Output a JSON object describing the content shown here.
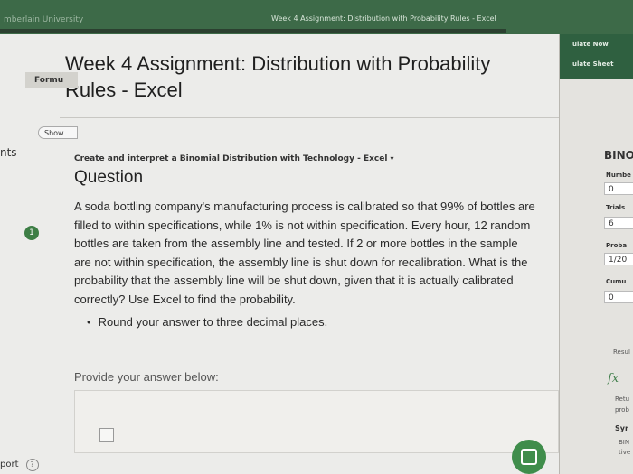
{
  "window": {
    "university_label": "mberlain University",
    "title": "Week 4 Assignment: Distribution with Probability Rules - Excel"
  },
  "page": {
    "title_line1": "Week 4 Assignment: Distribution with Probability",
    "title_line2": "Rules - Excel",
    "side_tab": "nts",
    "question_number": "1",
    "subtitle": "Create and interpret a Binomial Distribution with Technology - Excel",
    "question_heading": "Question",
    "question_lines": [
      "A soda bottling company's manufacturing process is calibrated so that 99% of bottles are",
      "filled to within specifications, while 1% is not within specification. Every hour, 12 random",
      "bottles are taken from the assembly line and tested. If 2 or more bottles in the sample",
      "are not within specification, the assembly line is shut down for recalibration. What is the",
      "probability that the assembly line will be shut down, given that it is actually calibrated",
      "correctly? Use Excel to find the probability."
    ],
    "bullet": "Round your answer to three decimal places.",
    "provide_label": "Provide your answer below:",
    "report_label": "port"
  },
  "sidebar": {
    "links": [
      "ulate Now",
      "ulate Sheet"
    ],
    "formula_tab": "Formu",
    "show_toggle": "Show",
    "function_title": "BINO",
    "fields": [
      {
        "label": "Numbe",
        "value": "0"
      },
      {
        "label": "Trials",
        "value": "6"
      },
      {
        "label": "Proba",
        "value": "1/20"
      },
      {
        "label": "Cumu",
        "value": "0"
      }
    ],
    "result_label": "Resul",
    "fx_label": "fx",
    "description_lines": [
      "Retu",
      "prob"
    ],
    "syntax_label": "Syr",
    "syntax_lines": [
      "BIN",
      "tive"
    ]
  }
}
